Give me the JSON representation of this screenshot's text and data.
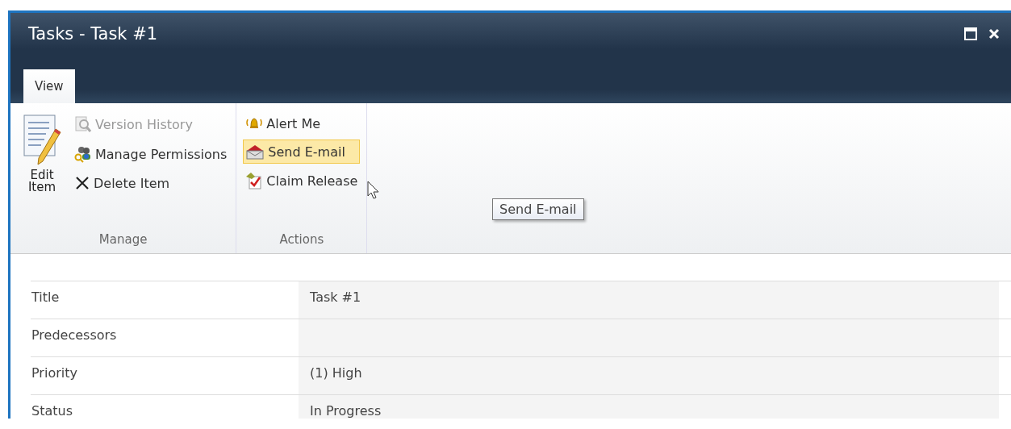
{
  "window": {
    "title": "Tasks - Task #1"
  },
  "tabs": [
    {
      "label": "View",
      "selected": true
    }
  ],
  "ribbon": {
    "groups": [
      {
        "label": "Manage",
        "large_button": {
          "label": "Edit Item",
          "disabled": false
        },
        "items": [
          {
            "kind": "version",
            "label": "Version History",
            "disabled": true
          },
          {
            "kind": "permissions",
            "label": "Manage Permissions",
            "disabled": false
          },
          {
            "kind": "delete",
            "label": "Delete Item",
            "disabled": false
          }
        ]
      },
      {
        "label": "Actions",
        "items": [
          {
            "kind": "alert",
            "label": "Alert Me",
            "disabled": false,
            "hovered": false
          },
          {
            "kind": "email",
            "label": "Send E-mail",
            "disabled": false,
            "hovered": true
          },
          {
            "kind": "claim",
            "label": "Claim Release",
            "disabled": false,
            "hovered": false
          }
        ]
      }
    ]
  },
  "tooltip": {
    "text": "Send E-mail"
  },
  "fields": [
    {
      "label": "Title",
      "value": "Task #1"
    },
    {
      "label": "Predecessors"
    },
    {
      "label": "Priority",
      "value": "(1) High"
    },
    {
      "label": "Status",
      "value": "In Progress"
    }
  ]
}
